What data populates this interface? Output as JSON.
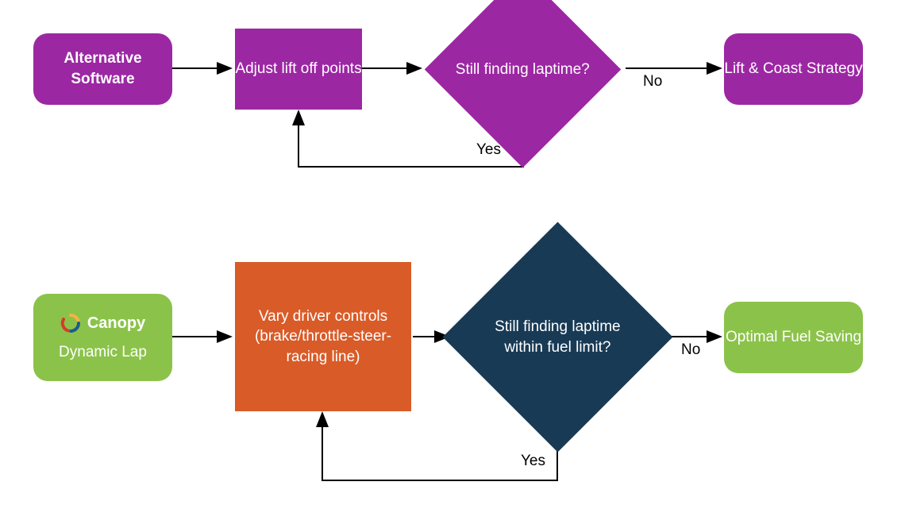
{
  "flowchart_top": {
    "start": {
      "label": "Alternative Software"
    },
    "process": {
      "label": "Adjust lift off points"
    },
    "decision": {
      "label": "Still finding laptime?",
      "yes_label": "Yes",
      "no_label": "No"
    },
    "result": {
      "label": "Lift & Coast Strategy"
    }
  },
  "flowchart_bottom": {
    "start": {
      "brand": "Canopy",
      "subtitle": "Dynamic Lap"
    },
    "process": {
      "label": "Vary  driver controls (brake/throttle-steer-racing line)"
    },
    "decision": {
      "label": "Still finding laptime within fuel limit?",
      "yes_label": "Yes",
      "no_label": "No"
    },
    "result": {
      "label": "Optimal Fuel Saving"
    }
  },
  "colors": {
    "purple": "#9c27a3",
    "orange": "#d95b28",
    "navy": "#183a55",
    "green": "#8bc34a"
  }
}
